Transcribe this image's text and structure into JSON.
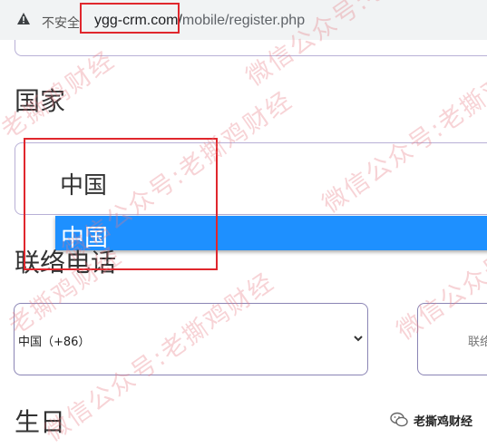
{
  "browser": {
    "security_label": "不安全",
    "url_host": "ygg-crm.com/",
    "url_path": "mobile/register.php"
  },
  "form": {
    "country_label": "国家",
    "country_value": "中国",
    "country_options": [
      "中国"
    ],
    "phone_label": "联络电话",
    "country_code_value": "中国（+86）",
    "phone_placeholder": "联络",
    "birthday_label": "生日"
  },
  "watermark": {
    "text_a": "微信公众号:老撕鸡财经",
    "text_b": "老撕鸡财经"
  },
  "badge": {
    "text": "老撕鸡财经"
  },
  "colors": {
    "highlight": "#1e90ff",
    "annotation_red": "#e0272d",
    "watermark": "#e77882"
  }
}
